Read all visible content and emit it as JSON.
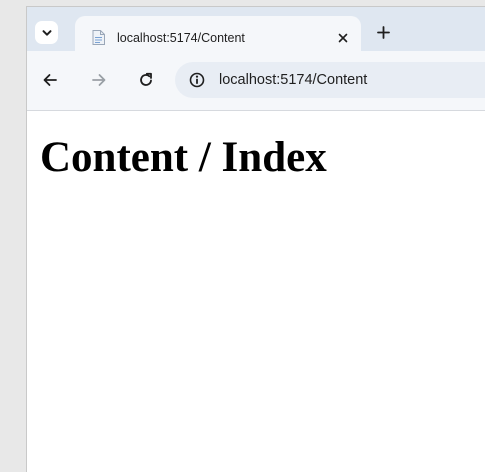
{
  "tab": {
    "title": "localhost:5174/Content"
  },
  "address_bar": {
    "url": "localhost:5174/Content"
  },
  "page": {
    "heading": "Content / Index"
  },
  "icons": {
    "tab_search": "chevron-down-icon",
    "favicon": "document-icon",
    "tab_close": "close-icon",
    "new_tab": "plus-icon",
    "back": "arrow-left-icon",
    "forward": "arrow-right-icon",
    "reload": "reload-icon",
    "site_info": "info-icon"
  },
  "colors": {
    "tabstrip_bg": "#dfe7f1",
    "toolbar_bg": "#f5f7fa",
    "omnibox_bg": "#e8edf4",
    "page_bg": "#ffffff"
  }
}
